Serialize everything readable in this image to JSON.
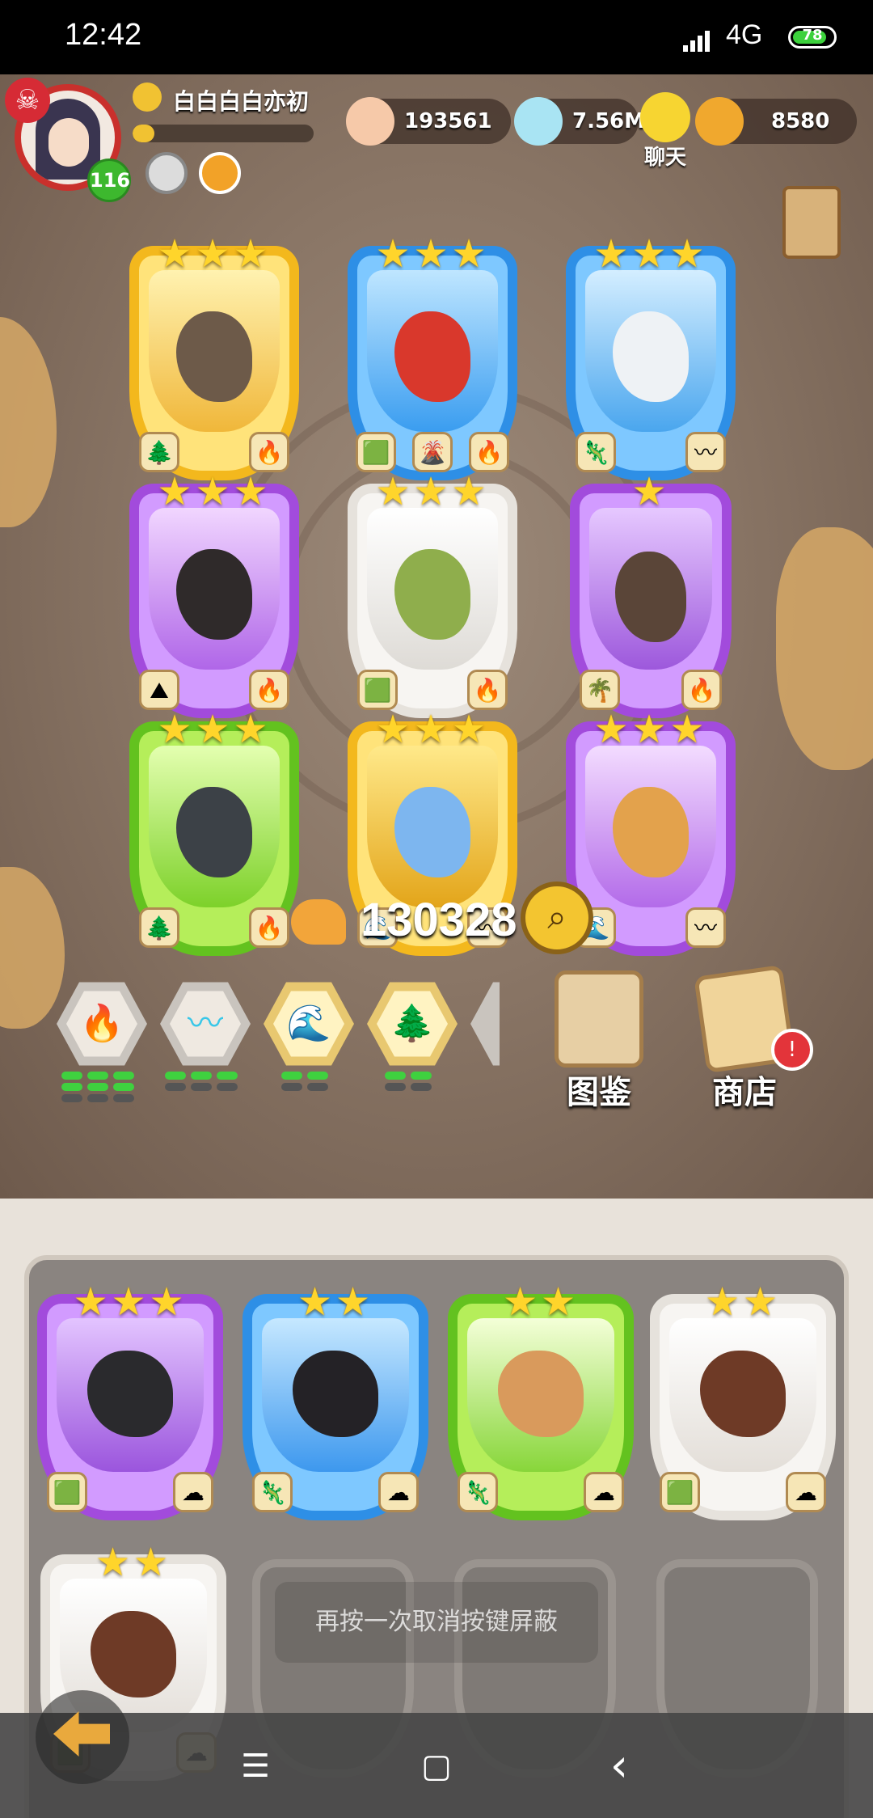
{
  "status_bar": {
    "time": "12:42",
    "network": "4G",
    "battery": "78"
  },
  "player": {
    "name": "白白白白亦初",
    "level": "116",
    "xp_fraction": 0.12
  },
  "resources": {
    "coins": "193561",
    "gems": "7.56M",
    "tokens": "8580",
    "chat_label": "聊天"
  },
  "collection": {
    "rows": [
      [
        {
          "stars": "★★★",
          "frame": "gold",
          "elements": [
            "tree",
            "fire"
          ]
        },
        {
          "stars": "★★★",
          "frame": "blue",
          "elements": [
            "grass",
            "volcano",
            "fire"
          ]
        },
        {
          "stars": "★★★",
          "frame": "blue",
          "elements": [
            "lizard",
            "wind"
          ]
        }
      ],
      [
        {
          "stars": "★★★",
          "frame": "purple",
          "elements": [
            "dirt",
            "fire"
          ]
        },
        {
          "stars": "★★★",
          "frame": "white",
          "elements": [
            "grass",
            "fire"
          ]
        },
        {
          "stars": "★",
          "frame": "purple",
          "elements": [
            "palm",
            "fire"
          ]
        }
      ],
      [
        {
          "stars": "★★★",
          "frame": "green",
          "elements": [
            "tree",
            "fire"
          ]
        },
        {
          "stars": "★★★",
          "frame": "gold",
          "elements": [
            "water",
            "wind"
          ]
        },
        {
          "stars": "★★★",
          "frame": "purple",
          "elements": [
            "water",
            "wind"
          ]
        }
      ]
    ]
  },
  "currency_total": "130328",
  "filters": [
    {
      "name": "fire",
      "color": "#e0352a",
      "pips_on": 6,
      "pips_total": 9
    },
    {
      "name": "wind",
      "color": "#39c7e8",
      "pips_on": 3,
      "pips_total": 3
    },
    {
      "name": "water",
      "color": "#2a7fd9",
      "pips_on": 2,
      "pips_total": 2
    },
    {
      "name": "tree",
      "color": "#2f9b3a",
      "pips_on": 2,
      "pips_total": 2
    }
  ],
  "buttons": {
    "codex": "图鉴",
    "shop": "商店",
    "notif": "!"
  },
  "team": [
    {
      "stars": "★★★",
      "frame": "purple",
      "elements": [
        "grass",
        "cotton"
      ]
    },
    {
      "stars": "★★",
      "frame": "blue",
      "elements": [
        "lizard",
        "cotton"
      ]
    },
    {
      "stars": "★★",
      "frame": "green",
      "elements": [
        "lizard",
        "cotton"
      ]
    },
    {
      "stars": "★★",
      "frame": "white",
      "elements": [
        "grass",
        "cotton"
      ]
    },
    {
      "stars": "★★",
      "frame": "white",
      "elements": [
        "grass",
        "cotton"
      ]
    }
  ],
  "toast": "再按一次取消按键屏蔽",
  "nav": {
    "menu": "☰",
    "home": "▢",
    "back": "‹"
  },
  "icons": {
    "skull": "☠",
    "search": "⌕"
  }
}
